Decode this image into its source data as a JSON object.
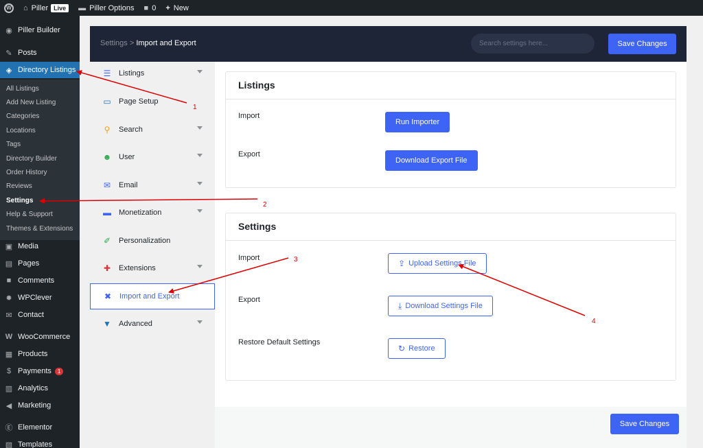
{
  "topbar": {
    "site_name": "Piller",
    "live_badge": "Live",
    "options_label": "Piller Options",
    "comments_count": "0",
    "new_label": "New"
  },
  "admin_menu": {
    "items": [
      {
        "label": "Piller Builder",
        "icon": "piller-builder-icon"
      },
      {
        "label": "Posts",
        "icon": "pin-icon"
      },
      {
        "label": "Directory Listings",
        "icon": "directory-icon"
      },
      {
        "label": "Media",
        "icon": "media-icon"
      },
      {
        "label": "Pages",
        "icon": "pages-icon"
      },
      {
        "label": "Comments",
        "icon": "comment-icon"
      },
      {
        "label": "WPClever",
        "icon": "wpclever-icon"
      },
      {
        "label": "Contact",
        "icon": "mail-icon"
      },
      {
        "label": "WooCommerce",
        "icon": "woocommerce-icon"
      },
      {
        "label": "Products",
        "icon": "products-icon"
      },
      {
        "label": "Payments",
        "icon": "payments-icon",
        "badge": "1"
      },
      {
        "label": "Analytics",
        "icon": "analytics-icon"
      },
      {
        "label": "Marketing",
        "icon": "marketing-icon"
      },
      {
        "label": "Elementor",
        "icon": "elementor-icon"
      },
      {
        "label": "Templates",
        "icon": "templates-icon"
      }
    ],
    "submenu": [
      "All Listings",
      "Add New Listing",
      "Categories",
      "Locations",
      "Tags",
      "Directory Builder",
      "Order History",
      "Reviews",
      "Settings",
      "Help & Support",
      "Themes & Extensions"
    ]
  },
  "settings_header": {
    "breadcrumb_root": "Settings",
    "breadcrumb_sep": ">",
    "breadcrumb_current": "Import and Export",
    "search_placeholder": "Search settings here...",
    "save_label": "Save Changes"
  },
  "settings_nav": [
    {
      "label": "Listings",
      "icon": "list-icon",
      "chevron": true
    },
    {
      "label": "Page Setup",
      "icon": "monitor-icon",
      "chevron": false
    },
    {
      "label": "Search",
      "icon": "search-icon",
      "chevron": true
    },
    {
      "label": "User",
      "icon": "users-icon",
      "chevron": true
    },
    {
      "label": "Email",
      "icon": "envelope-icon",
      "chevron": true
    },
    {
      "label": "Monetization",
      "icon": "credit-card-icon",
      "chevron": true
    },
    {
      "label": "Personalization",
      "icon": "brush-icon",
      "chevron": false
    },
    {
      "label": "Extensions",
      "icon": "puzzle-icon",
      "chevron": true
    },
    {
      "label": "Import and Export",
      "icon": "tools-icon",
      "chevron": false
    },
    {
      "label": "Advanced",
      "icon": "filter-icon",
      "chevron": true
    }
  ],
  "listings_card": {
    "title": "Listings",
    "import_label": "Import",
    "import_button": "Run Importer",
    "export_label": "Export",
    "export_button": "Download Export File"
  },
  "settings_card": {
    "title": "Settings",
    "import_label": "Import",
    "upload_button": "Upload Settings File",
    "export_label": "Export",
    "download_button": "Download Settings File",
    "restore_label": "Restore Default Settings",
    "restore_button": "Restore"
  },
  "footer": {
    "save_label": "Save Changes"
  },
  "annotations": [
    "1",
    "2",
    "3",
    "4"
  ],
  "colors": {
    "accent": "#3e64f5",
    "annotation": "#dd0000",
    "admin_bg": "#1d2327",
    "active_menu": "#2271b1"
  }
}
